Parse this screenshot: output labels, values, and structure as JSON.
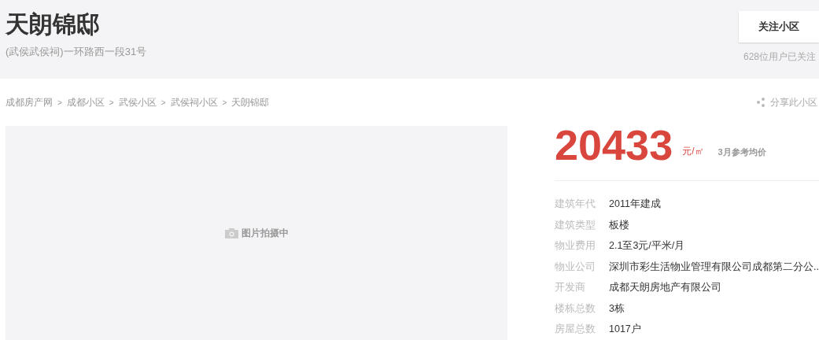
{
  "header": {
    "title": "天朗锦邸",
    "address": "(武侯武侯祠)一环路西一段31号",
    "follow_button": "关注小区",
    "followers": "628位用户已关注"
  },
  "breadcrumb": [
    "成都房产网",
    "成都小区",
    "武侯小区",
    "武侯祠小区",
    "天朗锦邸"
  ],
  "breadcrumb_separator": ">",
  "share": "分享此小区",
  "photo": {
    "caption": "图片拍摄中"
  },
  "price": {
    "value": "20433",
    "unit": "元/㎡",
    "note": "3月参考均价"
  },
  "details": [
    {
      "label": "建筑年代",
      "value": "2011年建成"
    },
    {
      "label": "建筑类型",
      "value": "板楼"
    },
    {
      "label": "物业费用",
      "value": "2.1至3元/平米/月"
    },
    {
      "label": "物业公司",
      "value": "深圳市彩生活物业管理有限公司成都第二分公.."
    },
    {
      "label": "开发商",
      "value": "成都天朗房地产有限公司"
    },
    {
      "label": "楼栋总数",
      "value": "3栋"
    },
    {
      "label": "房屋总数",
      "value": "1017户"
    }
  ]
}
